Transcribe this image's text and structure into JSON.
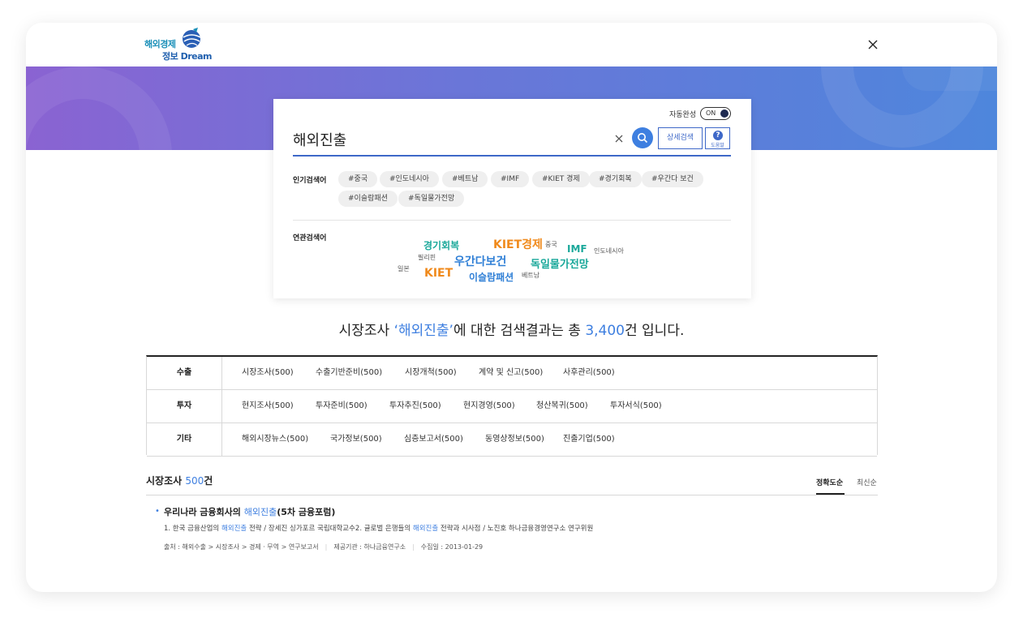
{
  "header": {
    "logo_line1": "해외경제",
    "logo_line2": "정보 Dream"
  },
  "search": {
    "auto_complete_label": "자동완성",
    "auto_complete_state": "ON",
    "query": "해외진출",
    "detail_button": "상세검색",
    "help_button": "도움말"
  },
  "popular": {
    "label": "인기검색어",
    "tags": [
      "#중국",
      "#인도네시아",
      "#베트남",
      "#IMF",
      "#KIET 경제",
      "#경기회복",
      "#우간다 보건",
      "#이슬람패션",
      "#독일물가전망"
    ]
  },
  "related": {
    "label": "연관검색어",
    "keywords": [
      "경기회복",
      "KIET경제",
      "중국",
      "IMF",
      "인도네시아",
      "필리핀",
      "우간다보건",
      "독일물가전망",
      "일본",
      "KIET",
      "이슬람패션",
      "베트남"
    ]
  },
  "summary": {
    "prefix": "시장조사 ",
    "query_quoted": "‘해외진출’",
    "middle": "에 대한 검색결과는 총 ",
    "count": "3,400",
    "suffix": "건 입니다."
  },
  "categories": [
    {
      "head": "수출",
      "items": [
        "시장조사(500)",
        "수출기반준비(500)",
        "시장개척(500)",
        "계약 및 신고(500)",
        "사후관리(500)"
      ]
    },
    {
      "head": "투자",
      "items": [
        "현지조사(500)",
        "투자준비(500)",
        "투자추진(500)",
        "현지경영(500)",
        "청산복귀(500)",
        "투자서식(500)"
      ]
    },
    {
      "head": "기타",
      "items": [
        "해외시장뉴스(500)",
        "국가정보(500)",
        "심층보고서(500)",
        "동영상정보(500)",
        "진출기업(500)"
      ]
    }
  ],
  "section": {
    "title": "시장조사 ",
    "count": "500",
    "unit": "건",
    "sort_accuracy": "정확도순",
    "sort_newest": "최신순"
  },
  "result": {
    "title_prefix": "우리나라 금융회사의 ",
    "title_highlight": "해외진출",
    "title_suffix": "(5차 금융포럼)",
    "desc_1": "1. 한국 금융산업의 ",
    "desc_hl_1": "해외진출",
    "desc_2": " 전략 / 장세진 싱가포르 국립대학교수2. 글로벌 은행들의 ",
    "desc_hl_2": "해외진출",
    "desc_3": " 전략과 시사점 / 노진호 하나금융경영연구소 연구위원",
    "meta_source": "출처 : 해외수출 > 시장조사 > 경제 · 무역 > 연구보고서",
    "meta_provider": "제공기관 : 하나금융연구소",
    "meta_date": "수집일 : 2013-01-29"
  },
  "colors": {
    "accent_blue": "#3e7fe0",
    "keyword_teal": "#1aa89a",
    "keyword_orange": "#f08a1c",
    "keyword_blue": "#2f7fd6"
  }
}
